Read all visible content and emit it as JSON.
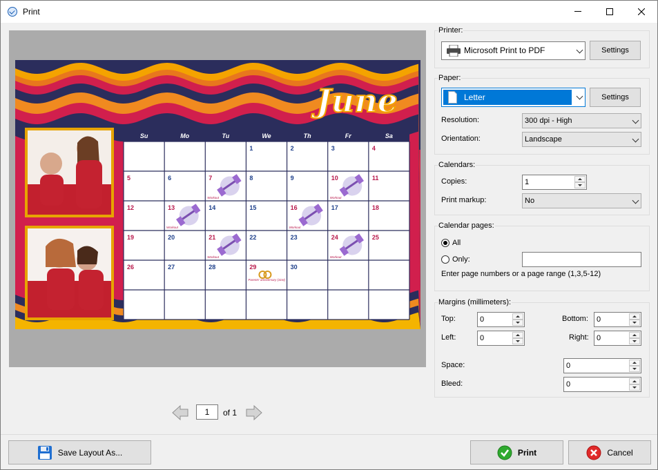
{
  "window": {
    "title": "Print"
  },
  "preview": {
    "month": "June",
    "day_headers": [
      "Su",
      "Mo",
      "Tu",
      "We",
      "Th",
      "Fr",
      "Sa"
    ],
    "weeks": [
      [
        "",
        "",
        "",
        "1",
        "2",
        "3",
        "4"
      ],
      [
        "5",
        "6",
        "7",
        "8",
        "9",
        "10",
        "11"
      ],
      [
        "12",
        "13",
        "14",
        "15",
        "16",
        "17",
        "18"
      ],
      [
        "19",
        "20",
        "21",
        "22",
        "23",
        "24",
        "25"
      ],
      [
        "26",
        "27",
        "28",
        "29",
        "30",
        "",
        ""
      ],
      [
        "",
        "",
        "",
        "",
        "",
        "",
        ""
      ]
    ],
    "workout_days": [
      "7",
      "10",
      "13",
      "16",
      "21",
      "24"
    ],
    "workout_label": "Workout",
    "anniversary_day": "29",
    "anniversary_label": "Parents' anniversary (31st)"
  },
  "pager": {
    "current_page": "1",
    "of_label": "of 1"
  },
  "printer": {
    "group_label": "Printer:",
    "selected": "Microsoft Print to PDF",
    "settings_label": "Settings"
  },
  "paper": {
    "group_label": "Paper:",
    "selected": "Letter",
    "settings_label": "Settings",
    "resolution_label": "Resolution:",
    "resolution_value": "300 dpi - High",
    "orientation_label": "Orientation:",
    "orientation_value": "Landscape"
  },
  "calendars": {
    "group_label": "Calendars:",
    "copies_label": "Copies:",
    "copies_value": "1",
    "markup_label": "Print markup:",
    "markup_value": "No"
  },
  "calendar_pages": {
    "group_label": "Calendar pages:",
    "all_label": "All",
    "only_label": "Only:",
    "hint": "Enter page numbers or a page range (1,3,5-12)"
  },
  "margins": {
    "group_label": "Margins (millimeters):",
    "top_label": "Top:",
    "top_value": "0",
    "bottom_label": "Bottom:",
    "bottom_value": "0",
    "left_label": "Left:",
    "left_value": "0",
    "right_label": "Right:",
    "right_value": "0",
    "space_label": "Space:",
    "space_value": "0",
    "bleed_label": "Bleed:",
    "bleed_value": "0"
  },
  "footer": {
    "save_layout_label": "Save Layout As...",
    "print_label": "Print",
    "cancel_label": "Cancel"
  },
  "colors": {
    "accent": "#0078d7",
    "calendar_header": "#2b2d5c",
    "weekend_day": "#b8174a",
    "weekday": "#1d3f8a"
  }
}
